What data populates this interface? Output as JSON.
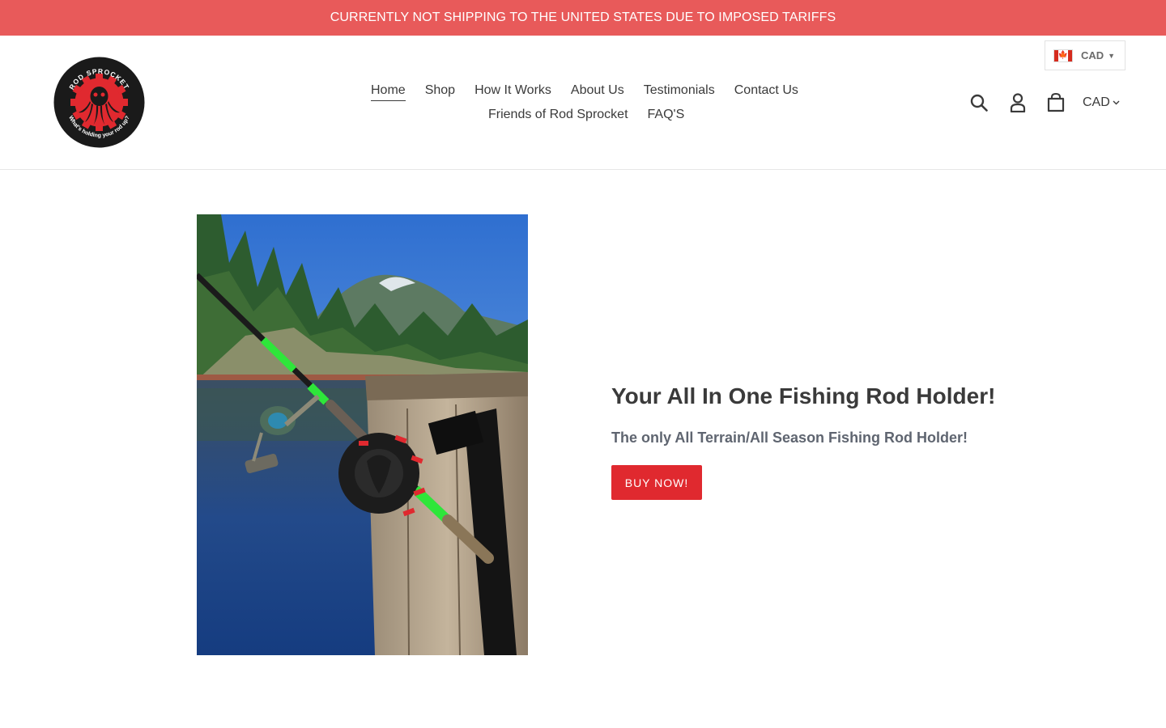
{
  "announcement": {
    "text": "CURRENTLY NOT SHIPPING TO THE UNITED STATES DUE TO IMPOSED TARIFFS"
  },
  "brand": {
    "logo_text_top": "ROD SPROCKET",
    "logo_text_bottom": "What's holding your rod up?",
    "logo_color": "#e0292f"
  },
  "nav": {
    "row1": [
      "Home",
      "Shop",
      "How It Works",
      "About Us",
      "Testimonials",
      "Contact Us"
    ],
    "row2": [
      "Friends of Rod Sprocket",
      "FAQ'S"
    ],
    "active": "Home"
  },
  "currency_widget": {
    "code": "CAD",
    "flag": "canada-flag"
  },
  "header_icons": [
    "search-icon",
    "account-icon",
    "cart-icon"
  ],
  "currency_select": {
    "value": "CAD"
  },
  "hero": {
    "title": "Your All In One Fishing Rod Holder!",
    "subtitle": "The only All Terrain/All Season Fishing Rod Holder!",
    "button_label": "BUY NOW!"
  },
  "colors": {
    "announcement_bg": "#e85a5a",
    "button_bg": "#e0292f"
  }
}
